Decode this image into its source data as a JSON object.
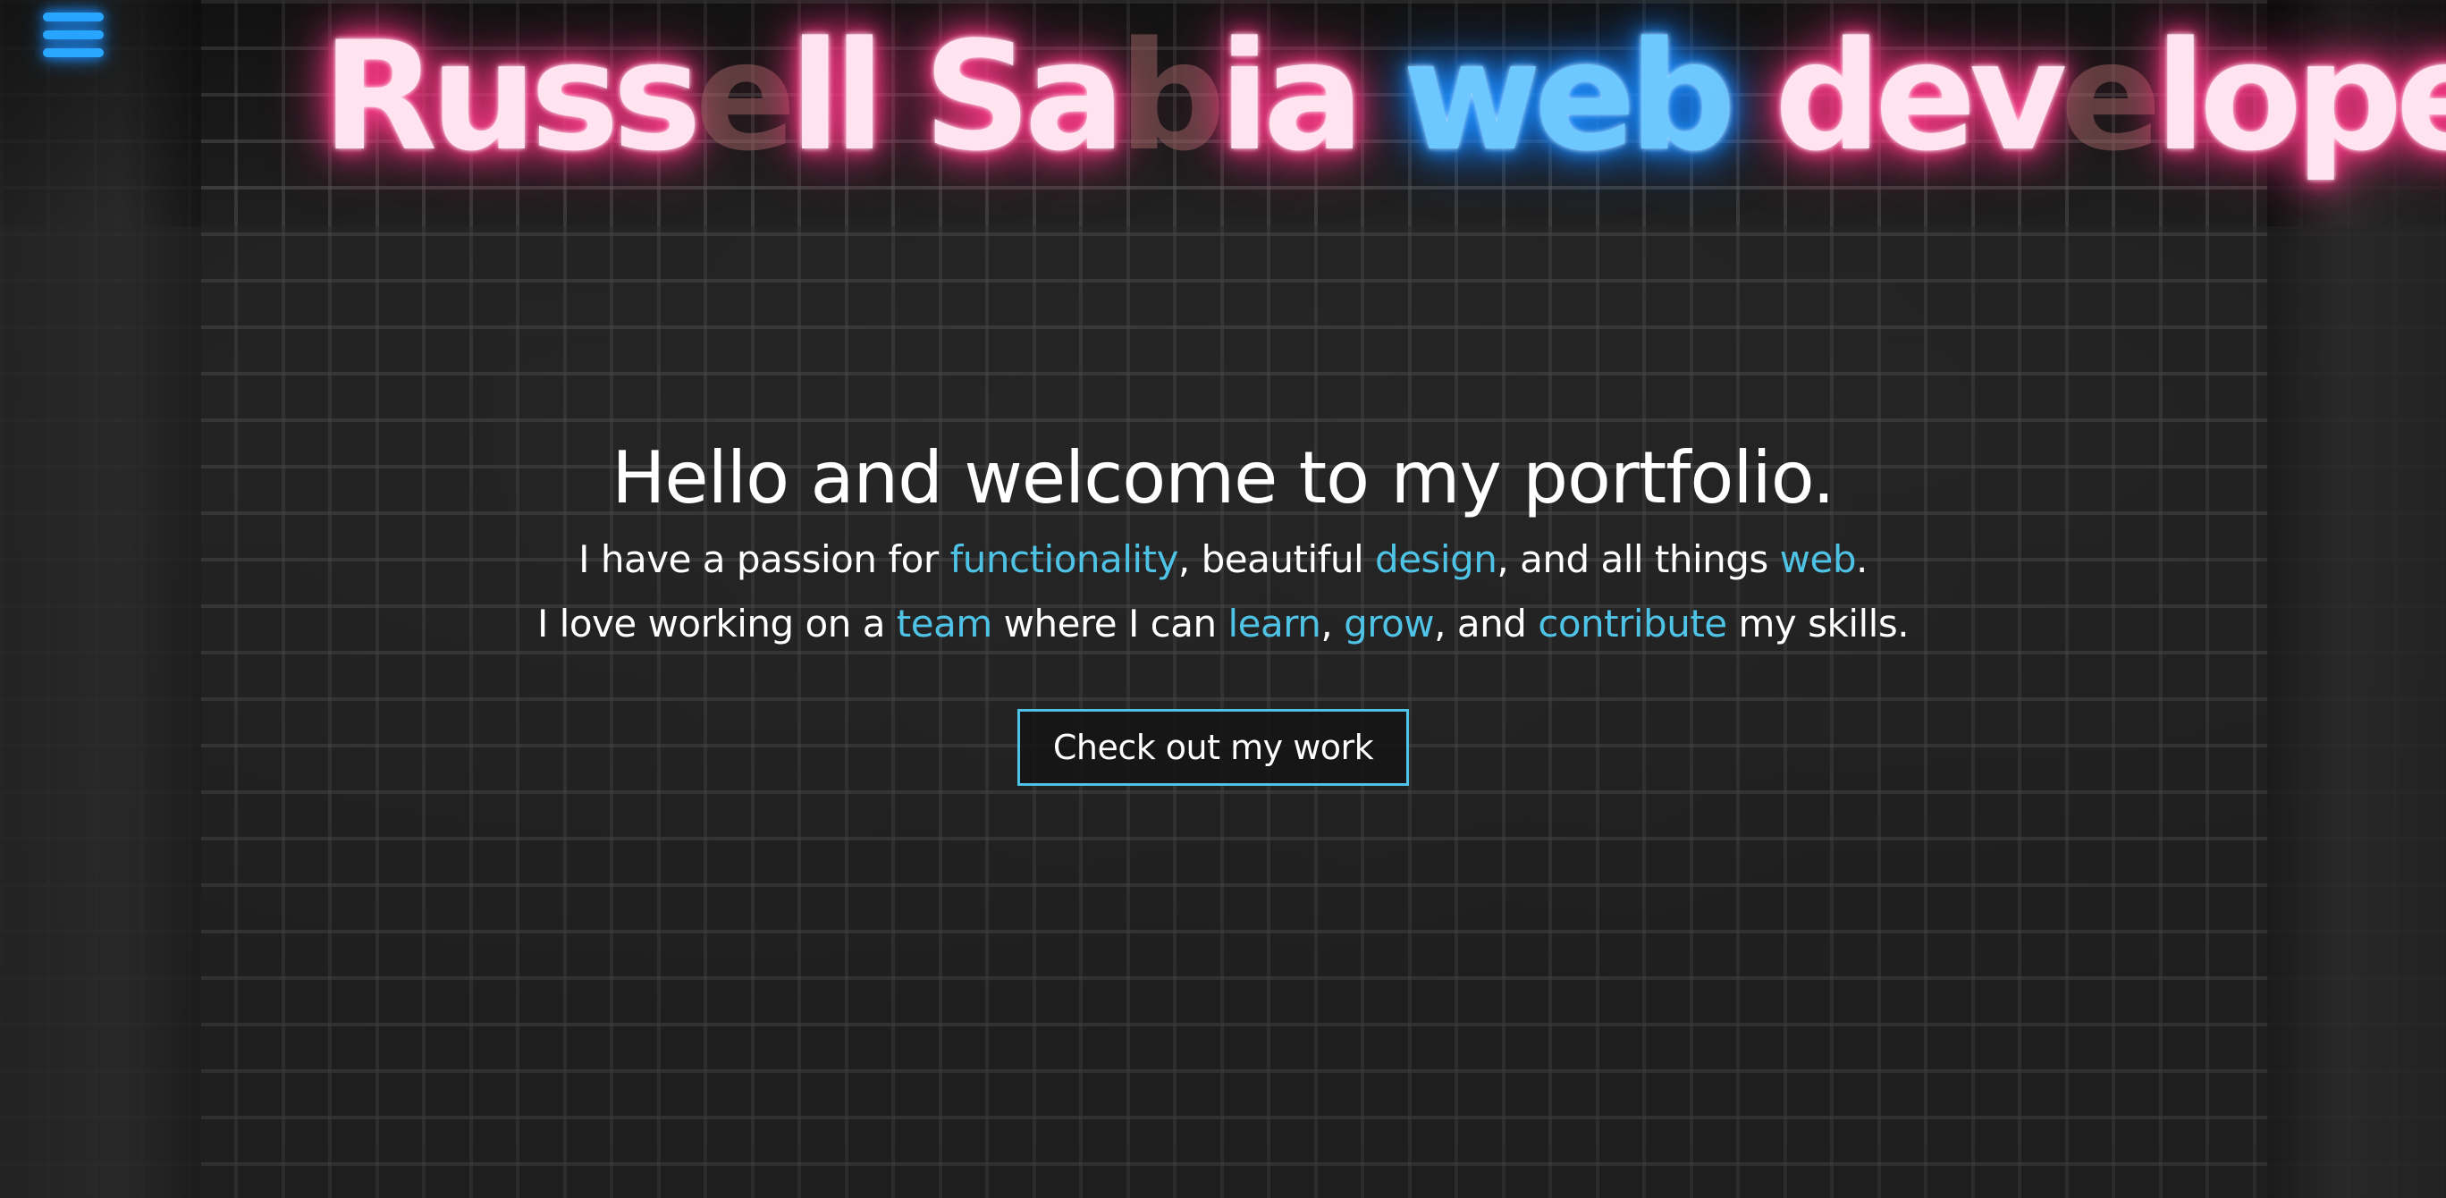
{
  "title": {
    "segments": [
      {
        "text": "Russ",
        "style": "pink"
      },
      {
        "text": "e",
        "style": "off"
      },
      {
        "text": "ll Sa",
        "style": "pink"
      },
      {
        "text": "b",
        "style": "off"
      },
      {
        "text": "ia ",
        "style": "pink"
      },
      {
        "text": "web",
        "style": "blue"
      },
      {
        "text": " dev",
        "style": "pink"
      },
      {
        "text": "e",
        "style": "off"
      },
      {
        "text": "loper",
        "style": "pink"
      }
    ]
  },
  "menu": {
    "icon": "hamburger-menu-icon",
    "color": "#2aa7ff"
  },
  "hero": {
    "heading": "Hello and welcome to my portfolio.",
    "line1": {
      "p1": "I have a passion for ",
      "w1": "functionality",
      "p2": ", beautiful ",
      "w2": "design",
      "p3": ", and all things ",
      "w3": "web",
      "p4": "."
    },
    "line2": {
      "p1": "I love working on a ",
      "w1": "team",
      "p2": " where I can ",
      "w2": "learn",
      "p3": ", ",
      "w3": "grow",
      "p4": ", and ",
      "w4": "contribute",
      "p5": " my skills."
    },
    "cta_label": "Check out my work"
  },
  "colors": {
    "accent": "#4fc3e6",
    "neon_pink": "#ff3d8b",
    "neon_blue": "#1e90ff"
  }
}
